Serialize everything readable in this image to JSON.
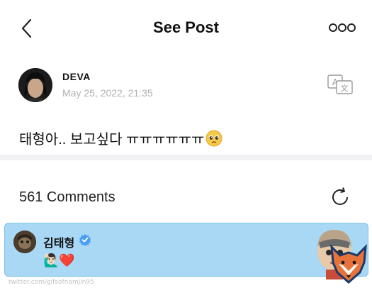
{
  "header": {
    "title": "See Post"
  },
  "post": {
    "author": "DEVA",
    "date": "May 25, 2022, 21:35",
    "text": "태형아.. 보고싶다 ㅠㅠㅠㅠㅠㅠ"
  },
  "comments": {
    "count_label": "561 Comments",
    "items": [
      {
        "author": "김태형",
        "verified": true,
        "text": "🙋🏻‍♂️❤️"
      }
    ]
  },
  "watermark": "twitter.com/gifsofnamjin95",
  "colors": {
    "highlight": "#a9d8f5",
    "verified": "#4b9df0",
    "date_gray": "#b0b0b0"
  },
  "icons": [
    "back-arrow-icon",
    "more-dots-icon",
    "translate-icon",
    "refresh-icon",
    "verified-badge-icon",
    "pleading-face-emoji"
  ]
}
